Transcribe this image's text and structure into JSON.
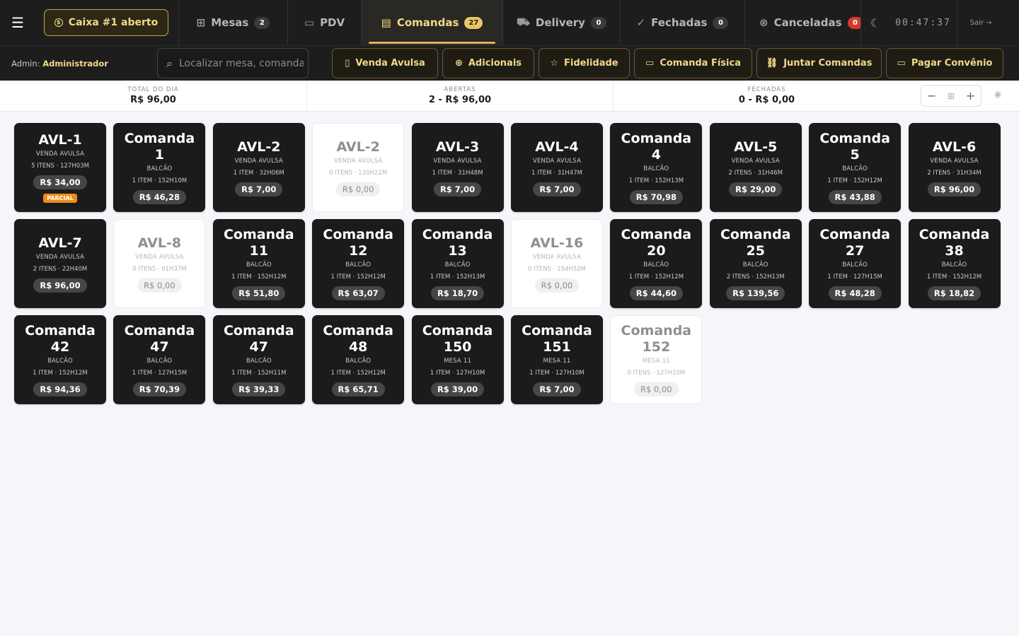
{
  "nav": {
    "caixa_label": "Caixa #1 aberto",
    "tabs": [
      {
        "key": "mesas",
        "label": "Mesas",
        "badge": "2",
        "icon": "grid-icon"
      },
      {
        "key": "pdv",
        "label": "PDV",
        "badge": "",
        "icon": "monitor-icon"
      },
      {
        "key": "comandas",
        "label": "Comandas",
        "badge": "27",
        "icon": "document-icon",
        "active": true
      },
      {
        "key": "delivery",
        "label": "Delivery",
        "badge": "0",
        "icon": "truck-icon"
      },
      {
        "key": "fechadas",
        "label": "Fechadas",
        "badge": "0",
        "icon": "check-circle-icon"
      },
      {
        "key": "canceladas",
        "label": "Canceladas",
        "badge": "0",
        "icon": "x-circle-icon"
      }
    ],
    "clock": "00:47:37",
    "logout_label": "Sair"
  },
  "actionbar": {
    "admin_prefix": "Admin:",
    "admin_name": "Administrador",
    "search_placeholder": "Localizar mesa, comanda...",
    "buttons": [
      "Venda Avulsa",
      "Adicionais",
      "Fidelidade",
      "Comanda Física",
      "Juntar Comandas",
      "Pagar Convênio"
    ]
  },
  "stats": [
    {
      "label": "TOTAL DO DIA",
      "value": "R$ 96,00"
    },
    {
      "label": "ABERTAS",
      "value": "2 - R$ 96,00"
    },
    {
      "label": "FECHADAS",
      "value": "0 - R$ 0,00"
    }
  ],
  "cards": [
    {
      "title": "AVL-1",
      "type": "VENDA AVULSA",
      "meta": "5 ITENS · 127H03M",
      "price": "R$ 34,00",
      "badge": "PARCIAL",
      "empty": false
    },
    {
      "title": "Comanda 1",
      "type": "BALCÃO",
      "meta": "1 ITEM · 152H10M",
      "price": "R$ 46,28",
      "empty": false
    },
    {
      "title": "AVL-2",
      "type": "VENDA AVULSA",
      "meta": "1 ITEM · 32H06M",
      "price": "R$ 7,00",
      "empty": false
    },
    {
      "title": "AVL-2",
      "type": "VENDA AVULSA",
      "meta": "0 ITENS · 120H22M",
      "price": "R$ 0,00",
      "empty": true
    },
    {
      "title": "AVL-3",
      "type": "VENDA AVULSA",
      "meta": "1 ITEM · 31H48M",
      "price": "R$ 7,00",
      "empty": false
    },
    {
      "title": "AVL-4",
      "type": "VENDA AVULSA",
      "meta": "1 ITEM · 31H47M",
      "price": "R$ 7,00",
      "empty": false
    },
    {
      "title": "Comanda 4",
      "type": "BALCÃO",
      "meta": "1 ITEM · 152H13M",
      "price": "R$ 70,98",
      "empty": false
    },
    {
      "title": "AVL-5",
      "type": "VENDA AVULSA",
      "meta": "2 ITENS · 31H46M",
      "price": "R$ 29,00",
      "empty": false
    },
    {
      "title": "Comanda 5",
      "type": "BALCÃO",
      "meta": "1 ITEM · 152H12M",
      "price": "R$ 43,88",
      "empty": false
    },
    {
      "title": "AVL-6",
      "type": "VENDA AVULSA",
      "meta": "2 ITENS · 31H34M",
      "price": "R$ 96,00",
      "empty": false
    },
    {
      "title": "AVL-7",
      "type": "VENDA AVULSA",
      "meta": "2 ITENS · 22H40M",
      "price": "R$ 96,00",
      "empty": false
    },
    {
      "title": "AVL-8",
      "type": "VENDA AVULSA",
      "meta": "0 ITENS · 01H37M",
      "price": "R$ 0,00",
      "empty": true
    },
    {
      "title": "Comanda 11",
      "type": "BALCÃO",
      "meta": "1 ITEM · 152H12M",
      "price": "R$ 51,80",
      "empty": false
    },
    {
      "title": "Comanda 12",
      "type": "BALCÃO",
      "meta": "1 ITEM · 152H12M",
      "price": "R$ 63,07",
      "empty": false
    },
    {
      "title": "Comanda 13",
      "type": "BALCÃO",
      "meta": "1 ITEM · 152H13M",
      "price": "R$ 18,70",
      "empty": false
    },
    {
      "title": "AVL-16",
      "type": "VENDA AVULSA",
      "meta": "0 ITENS · 154H52M",
      "price": "R$ 0,00",
      "empty": true
    },
    {
      "title": "Comanda 20",
      "type": "BALCÃO",
      "meta": "1 ITEM · 152H12M",
      "price": "R$ 44,60",
      "empty": false
    },
    {
      "title": "Comanda 25",
      "type": "BALCÃO",
      "meta": "2 ITENS · 152H13M",
      "price": "R$ 139,56",
      "empty": false
    },
    {
      "title": "Comanda 27",
      "type": "BALCÃO",
      "meta": "1 ITEM · 127H15M",
      "price": "R$ 48,28",
      "empty": false
    },
    {
      "title": "Comanda 38",
      "type": "BALCÃO",
      "meta": "1 ITEM · 152H12M",
      "price": "R$ 18,82",
      "empty": false
    },
    {
      "title": "Comanda 42",
      "type": "BALCÃO",
      "meta": "1 ITEM · 152H12M",
      "price": "R$ 94,36",
      "empty": false
    },
    {
      "title": "Comanda 47",
      "type": "BALCÃO",
      "meta": "1 ITEM · 127H15M",
      "price": "R$ 70,39",
      "empty": false
    },
    {
      "title": "Comanda 47",
      "type": "BALCÃO",
      "meta": "1 ITEM · 152H11M",
      "price": "R$ 39,33",
      "empty": false
    },
    {
      "title": "Comanda 48",
      "type": "BALCÃO",
      "meta": "1 ITEM · 152H12M",
      "price": "R$ 65,71",
      "empty": false
    },
    {
      "title": "Comanda 150",
      "type": "MESA 11",
      "meta": "1 ITEM · 127H10M",
      "price": "R$ 39,00",
      "empty": false
    },
    {
      "title": "Comanda 151",
      "type": "MESA 11",
      "meta": "1 ITEM · 127H10M",
      "price": "R$ 7,00",
      "empty": false
    },
    {
      "title": "Comanda 152",
      "type": "MESA 11",
      "meta": "0 ITENS · 127H10M",
      "price": "R$ 0,00",
      "empty": true
    }
  ],
  "colors": {
    "accent": "#f1d98a",
    "dark": "#1d1d1d",
    "badge_orange": "#f08c1b",
    "badge_red": "#d63a2c"
  }
}
